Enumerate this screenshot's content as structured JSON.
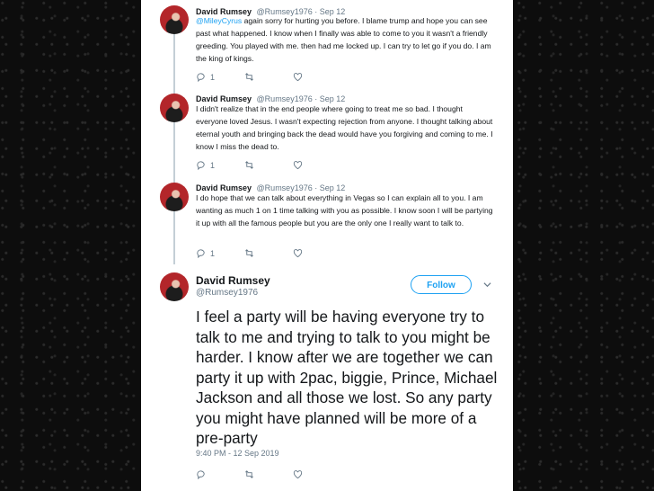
{
  "thread": [
    {
      "name": "David Rumsey",
      "handle": "@Rumsey1976",
      "date": "Sep 12",
      "mention": "@MileyCyrus",
      "text": " again sorry for hurting you before. I blame trump and hope you can see past what happened. I know when I finally was able to come to you it wasn't a friendly greeding. You played with me. then had me locked up. I can try to let go if you do. I am the king of kings.",
      "reply_count": "1",
      "retweet_count": "",
      "like_count": ""
    },
    {
      "name": "David Rumsey",
      "handle": "@Rumsey1976",
      "date": "Sep 12",
      "text": "I didn't realize that in the end people where going to treat me so bad. I thought everyone loved Jesus. I wasn't expecting rejection from anyone. I thought talking about eternal youth and bringing back the dead would have you forgiving and coming to me. I know I miss the dead to.",
      "reply_count": "1",
      "retweet_count": "",
      "like_count": ""
    },
    {
      "name": "David Rumsey",
      "handle": "@Rumsey1976",
      "date": "Sep 12",
      "text": "I do hope that we can talk about everything in Vegas so I can explain all to you. I am wanting as much 1 on 1 time talking with you as possible. I know soon I will be partying it up with all the famous people but you are the only one I really want to talk to.",
      "reply_count": "1",
      "retweet_count": "",
      "like_count": ""
    }
  ],
  "main_tweet": {
    "name": "David Rumsey",
    "handle": "@Rumsey1976",
    "follow_label": "Follow",
    "text": "I feel a party will be having everyone try to talk to me and trying to talk to you might be harder. I know after we are together we can party it up with 2pac, biggie, Prince, Michael Jackson and all those we lost. So any party you might have planned will be more of a pre-party",
    "timestamp": "9:40 PM - 12 Sep 2019"
  },
  "separator": "·",
  "colors": {
    "link": "#1da1f2",
    "text": "#14171a",
    "muted": "#657786",
    "thread_line": "#c4cfd6"
  }
}
